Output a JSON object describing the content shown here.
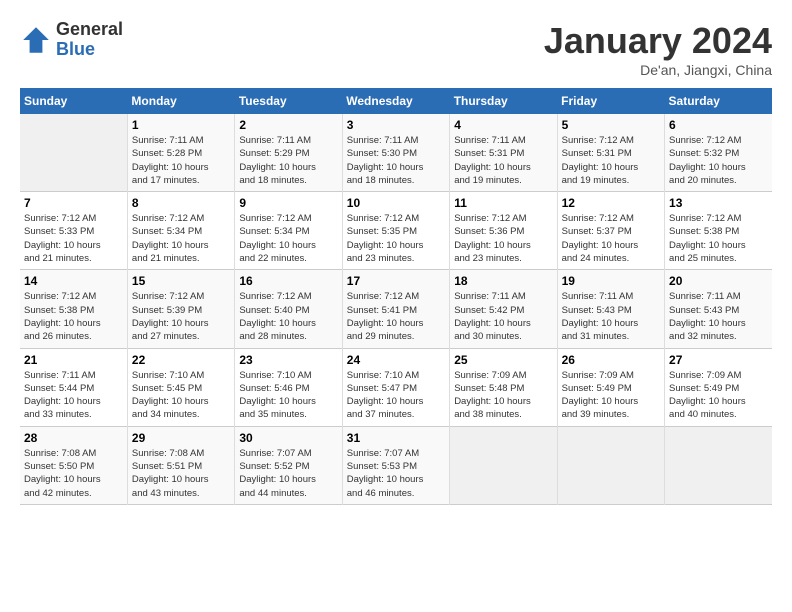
{
  "logo": {
    "general": "General",
    "blue": "Blue"
  },
  "title": "January 2024",
  "location": "De'an, Jiangxi, China",
  "days_header": [
    "Sunday",
    "Monday",
    "Tuesday",
    "Wednesday",
    "Thursday",
    "Friday",
    "Saturday"
  ],
  "weeks": [
    [
      {
        "day": "",
        "info": ""
      },
      {
        "day": "1",
        "info": "Sunrise: 7:11 AM\nSunset: 5:28 PM\nDaylight: 10 hours\nand 17 minutes."
      },
      {
        "day": "2",
        "info": "Sunrise: 7:11 AM\nSunset: 5:29 PM\nDaylight: 10 hours\nand 18 minutes."
      },
      {
        "day": "3",
        "info": "Sunrise: 7:11 AM\nSunset: 5:30 PM\nDaylight: 10 hours\nand 18 minutes."
      },
      {
        "day": "4",
        "info": "Sunrise: 7:11 AM\nSunset: 5:31 PM\nDaylight: 10 hours\nand 19 minutes."
      },
      {
        "day": "5",
        "info": "Sunrise: 7:12 AM\nSunset: 5:31 PM\nDaylight: 10 hours\nand 19 minutes."
      },
      {
        "day": "6",
        "info": "Sunrise: 7:12 AM\nSunset: 5:32 PM\nDaylight: 10 hours\nand 20 minutes."
      }
    ],
    [
      {
        "day": "7",
        "info": "Sunrise: 7:12 AM\nSunset: 5:33 PM\nDaylight: 10 hours\nand 21 minutes."
      },
      {
        "day": "8",
        "info": "Sunrise: 7:12 AM\nSunset: 5:34 PM\nDaylight: 10 hours\nand 21 minutes."
      },
      {
        "day": "9",
        "info": "Sunrise: 7:12 AM\nSunset: 5:34 PM\nDaylight: 10 hours\nand 22 minutes."
      },
      {
        "day": "10",
        "info": "Sunrise: 7:12 AM\nSunset: 5:35 PM\nDaylight: 10 hours\nand 23 minutes."
      },
      {
        "day": "11",
        "info": "Sunrise: 7:12 AM\nSunset: 5:36 PM\nDaylight: 10 hours\nand 23 minutes."
      },
      {
        "day": "12",
        "info": "Sunrise: 7:12 AM\nSunset: 5:37 PM\nDaylight: 10 hours\nand 24 minutes."
      },
      {
        "day": "13",
        "info": "Sunrise: 7:12 AM\nSunset: 5:38 PM\nDaylight: 10 hours\nand 25 minutes."
      }
    ],
    [
      {
        "day": "14",
        "info": "Sunrise: 7:12 AM\nSunset: 5:38 PM\nDaylight: 10 hours\nand 26 minutes."
      },
      {
        "day": "15",
        "info": "Sunrise: 7:12 AM\nSunset: 5:39 PM\nDaylight: 10 hours\nand 27 minutes."
      },
      {
        "day": "16",
        "info": "Sunrise: 7:12 AM\nSunset: 5:40 PM\nDaylight: 10 hours\nand 28 minutes."
      },
      {
        "day": "17",
        "info": "Sunrise: 7:12 AM\nSunset: 5:41 PM\nDaylight: 10 hours\nand 29 minutes."
      },
      {
        "day": "18",
        "info": "Sunrise: 7:11 AM\nSunset: 5:42 PM\nDaylight: 10 hours\nand 30 minutes."
      },
      {
        "day": "19",
        "info": "Sunrise: 7:11 AM\nSunset: 5:43 PM\nDaylight: 10 hours\nand 31 minutes."
      },
      {
        "day": "20",
        "info": "Sunrise: 7:11 AM\nSunset: 5:43 PM\nDaylight: 10 hours\nand 32 minutes."
      }
    ],
    [
      {
        "day": "21",
        "info": "Sunrise: 7:11 AM\nSunset: 5:44 PM\nDaylight: 10 hours\nand 33 minutes."
      },
      {
        "day": "22",
        "info": "Sunrise: 7:10 AM\nSunset: 5:45 PM\nDaylight: 10 hours\nand 34 minutes."
      },
      {
        "day": "23",
        "info": "Sunrise: 7:10 AM\nSunset: 5:46 PM\nDaylight: 10 hours\nand 35 minutes."
      },
      {
        "day": "24",
        "info": "Sunrise: 7:10 AM\nSunset: 5:47 PM\nDaylight: 10 hours\nand 37 minutes."
      },
      {
        "day": "25",
        "info": "Sunrise: 7:09 AM\nSunset: 5:48 PM\nDaylight: 10 hours\nand 38 minutes."
      },
      {
        "day": "26",
        "info": "Sunrise: 7:09 AM\nSunset: 5:49 PM\nDaylight: 10 hours\nand 39 minutes."
      },
      {
        "day": "27",
        "info": "Sunrise: 7:09 AM\nSunset: 5:49 PM\nDaylight: 10 hours\nand 40 minutes."
      }
    ],
    [
      {
        "day": "28",
        "info": "Sunrise: 7:08 AM\nSunset: 5:50 PM\nDaylight: 10 hours\nand 42 minutes."
      },
      {
        "day": "29",
        "info": "Sunrise: 7:08 AM\nSunset: 5:51 PM\nDaylight: 10 hours\nand 43 minutes."
      },
      {
        "day": "30",
        "info": "Sunrise: 7:07 AM\nSunset: 5:52 PM\nDaylight: 10 hours\nand 44 minutes."
      },
      {
        "day": "31",
        "info": "Sunrise: 7:07 AM\nSunset: 5:53 PM\nDaylight: 10 hours\nand 46 minutes."
      },
      {
        "day": "",
        "info": ""
      },
      {
        "day": "",
        "info": ""
      },
      {
        "day": "",
        "info": ""
      }
    ]
  ]
}
